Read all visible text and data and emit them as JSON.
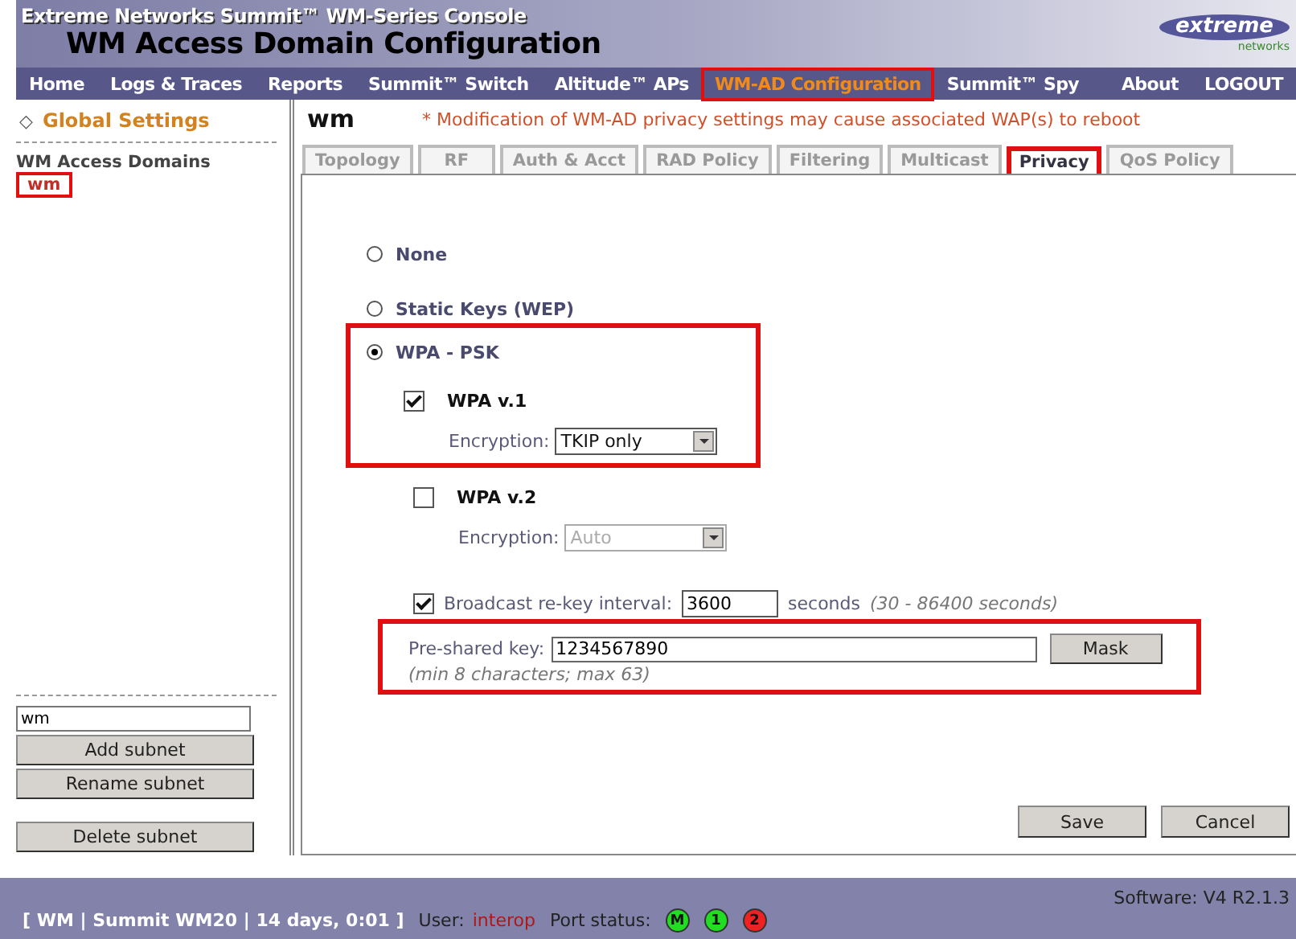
{
  "header": {
    "subtitle": "Extreme Networks Summit™ WM-Series Console",
    "title": "WM Access Domain Configuration",
    "logo": {
      "word": "extreme",
      "tagline": "networks"
    }
  },
  "nav": {
    "items": [
      {
        "label": "Home",
        "highlighted": false
      },
      {
        "label": "Logs & Traces",
        "highlighted": false
      },
      {
        "label": "Reports",
        "highlighted": false
      },
      {
        "label": "Summit™ Switch",
        "highlighted": false
      },
      {
        "label": "Altitude™ APs",
        "highlighted": false
      },
      {
        "label": "WM-AD Configuration",
        "highlighted": true
      },
      {
        "label": "Summit™ Spy",
        "highlighted": false
      }
    ],
    "right_items": [
      "About",
      "LOGOUT"
    ]
  },
  "sidebar": {
    "global_icon": "◇",
    "global_settings": "Global Settings",
    "section": "WM Access Domains",
    "items": [
      {
        "label": "wm",
        "highlighted": true
      }
    ],
    "name_field": {
      "value": "wm"
    },
    "buttons": [
      "Add subnet",
      "Rename subnet"
    ],
    "delete_button": "Delete subnet"
  },
  "content": {
    "title": "wm",
    "warning": "* Modification of WM-AD privacy settings may cause associated WAP(s) to reboot",
    "tabs": [
      {
        "label": "Topology",
        "selected": false,
        "highlighted": false
      },
      {
        "label": "RF",
        "selected": false,
        "highlighted": false
      },
      {
        "label": "Auth & Acct",
        "selected": false,
        "highlighted": false
      },
      {
        "label": "RAD Policy",
        "selected": false,
        "highlighted": false
      },
      {
        "label": "Filtering",
        "selected": false,
        "highlighted": false
      },
      {
        "label": "Multicast",
        "selected": false,
        "highlighted": false
      },
      {
        "label": "Privacy",
        "selected": true,
        "highlighted": true
      },
      {
        "label": "QoS Policy",
        "selected": false,
        "highlighted": false
      }
    ],
    "privacy_options": [
      {
        "label": "None",
        "selected": false
      },
      {
        "label": "Static Keys (WEP)",
        "selected": false
      },
      {
        "label": "WPA - PSK",
        "selected": true
      }
    ],
    "wpa_psk_highlighted": true,
    "wpa_versions": [
      {
        "label": "WPA v.1",
        "checked": true,
        "encryption_label": "Encryption:",
        "encryption": "TKIP only",
        "disabled": false
      },
      {
        "label": "WPA v.2",
        "checked": false,
        "encryption_label": "Encryption:",
        "encryption": "Auto",
        "disabled": true
      }
    ],
    "rekey": {
      "checked": true,
      "label": "Broadcast re-key interval:",
      "value": "3600",
      "unit": "seconds",
      "range": "(30 - 86400 seconds)"
    },
    "psk": {
      "label": "Pre-shared key:",
      "value": "1234567890",
      "button": "Mask",
      "hint": "(min 8 characters; max 63)",
      "highlighted": true
    },
    "buttons": [
      "Save",
      "Cancel"
    ]
  },
  "status_bar": {
    "software": "Software: V4 R2.1.3",
    "system": "[ WM | Summit WM20 | 14 days, 0:01 ]",
    "user_label": "User:",
    "user": "interop",
    "port_label": "Port status:",
    "ports": [
      {
        "label": "M",
        "color": "#22dd22"
      },
      {
        "label": "1",
        "color": "#22dd22"
      },
      {
        "label": "2",
        "color": "#ee2222"
      }
    ]
  }
}
